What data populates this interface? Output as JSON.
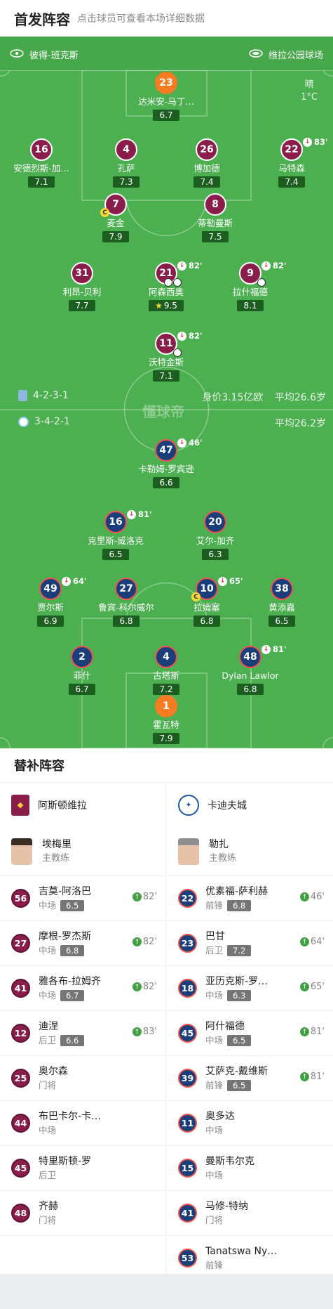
{
  "header": {
    "title": "首发阵容",
    "subtitle": "点击球员可查看本场详细数据"
  },
  "pitch": {
    "home_team": "彼得-班克斯",
    "venue": "维拉公园球场",
    "weather": "晴",
    "temperature": "1°C",
    "watermark": "懂球帝",
    "home_formation": "4-2-3-1",
    "home_value": "身价3.15亿欧",
    "home_age": "平均26.6岁",
    "away_formation": "3-4-2-1",
    "away_age": "平均26.2岁"
  },
  "home_players": [
    {
      "num": "23",
      "name": "达米安-马丁…",
      "rating": "6.7",
      "gk": true
    },
    {
      "num": "16",
      "name": "安德烈斯-加…",
      "rating": "7.1"
    },
    {
      "num": "4",
      "name": "孔萨",
      "rating": "7.3"
    },
    {
      "num": "26",
      "name": "博加德",
      "rating": "7.4"
    },
    {
      "num": "22",
      "name": "马特森",
      "rating": "7.4",
      "sub": "83'"
    },
    {
      "num": "7",
      "name": "麦金",
      "rating": "7.9",
      "captain": "C"
    },
    {
      "num": "8",
      "name": "蒂勒曼斯",
      "rating": "7.5"
    },
    {
      "num": "31",
      "name": "利昂-贝利",
      "rating": "7.7"
    },
    {
      "num": "21",
      "name": "阿森西奥",
      "rating": "9.5",
      "sub": "82'"
    },
    {
      "num": "9",
      "name": "拉什福德",
      "rating": "8.1",
      "sub": "82'"
    },
    {
      "num": "11",
      "name": "沃特金斯",
      "rating": "7.1",
      "sub": "82'"
    }
  ],
  "away_players": [
    {
      "num": "47",
      "name": "卡勒姆-罗宾逊",
      "rating": "6.6",
      "sub": "46'"
    },
    {
      "num": "16",
      "name": "克里斯-威洛克",
      "rating": "6.5",
      "sub": "81'"
    },
    {
      "num": "20",
      "name": "艾尔-加齐",
      "rating": "6.3"
    },
    {
      "num": "49",
      "name": "贾尔斯",
      "rating": "6.9",
      "sub": "64'"
    },
    {
      "num": "27",
      "name": "鲁宾-科尔威尔",
      "rating": "6.8"
    },
    {
      "num": "10",
      "name": "拉姆塞",
      "rating": "6.8",
      "sub": "65'",
      "captain": "C"
    },
    {
      "num": "38",
      "name": "黄添嘉",
      "rating": "6.5"
    },
    {
      "num": "2",
      "name": "菲什",
      "rating": "6.7"
    },
    {
      "num": "4",
      "name": "古塔斯",
      "rating": "7.2"
    },
    {
      "num": "48",
      "name": "Dylan Lawlor",
      "rating": "6.8",
      "sub": "81'"
    },
    {
      "num": "1",
      "name": "霍瓦特",
      "rating": "7.9",
      "gk": true
    }
  ],
  "subs": {
    "title": "替补阵容",
    "home": {
      "team": "阿斯顿维拉",
      "coach": {
        "name": "埃梅里",
        "role": "主教练"
      },
      "players": [
        {
          "num": "56",
          "name": "吉莫-阿洛巴",
          "pos": "中场",
          "rating": "6.5",
          "in": "82'"
        },
        {
          "num": "27",
          "name": "摩根-罗杰斯",
          "pos": "中场",
          "rating": "6.8",
          "in": "82'"
        },
        {
          "num": "41",
          "name": "雅各布-拉姆齐",
          "pos": "中场",
          "rating": "6.7",
          "in": "82'"
        },
        {
          "num": "12",
          "name": "迪涅",
          "pos": "后卫",
          "rating": "6.6",
          "in": "83'"
        },
        {
          "num": "25",
          "name": "奥尔森",
          "pos": "门将"
        },
        {
          "num": "44",
          "name": "布巴卡尔-卡…",
          "pos": "中场"
        },
        {
          "num": "45",
          "name": "特里斯顿-罗",
          "pos": "后卫"
        },
        {
          "num": "48",
          "name": "齐赫",
          "pos": "门将"
        }
      ]
    },
    "away": {
      "team": "卡迪夫城",
      "coach": {
        "name": "勒扎",
        "role": "主教练"
      },
      "players": [
        {
          "num": "22",
          "name": "优素福-萨利赫",
          "pos": "前锋",
          "rating": "6.8",
          "in": "46'"
        },
        {
          "num": "23",
          "name": "巴甘",
          "pos": "后卫",
          "rating": "7.2",
          "in": "64'"
        },
        {
          "num": "18",
          "name": "亚历克斯-罗…",
          "pos": "中场",
          "rating": "6.3",
          "in": "65'"
        },
        {
          "num": "45",
          "name": "阿什福德",
          "pos": "中场",
          "rating": "6.5",
          "in": "81'"
        },
        {
          "num": "39",
          "name": "艾萨克-戴维斯",
          "pos": "前锋",
          "rating": "6.5",
          "in": "81'"
        },
        {
          "num": "11",
          "name": "奥多达",
          "pos": "中场"
        },
        {
          "num": "15",
          "name": "曼斯韦尔克",
          "pos": "中场"
        },
        {
          "num": "41",
          "name": "马修-特纳",
          "pos": "门将"
        },
        {
          "num": "53",
          "name": "Tanatswa Ny…",
          "pos": "前锋"
        }
      ]
    }
  }
}
